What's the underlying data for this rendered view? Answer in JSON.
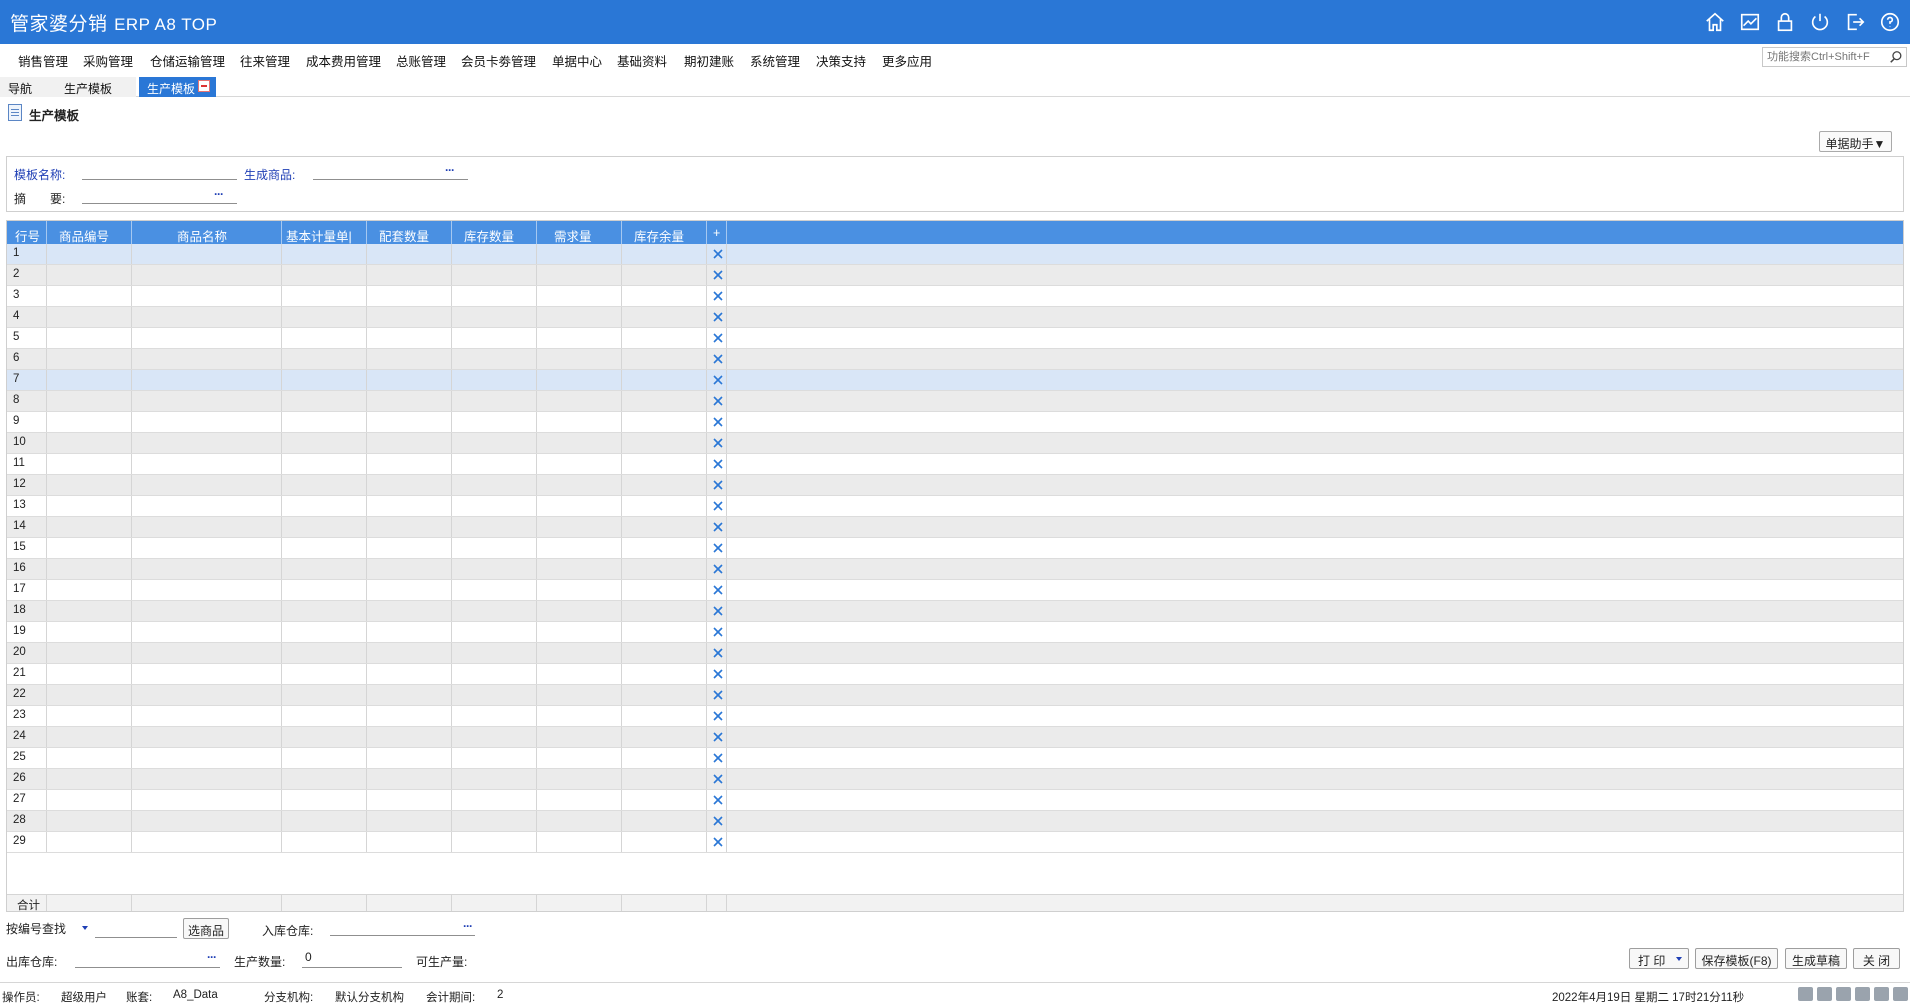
{
  "app": {
    "title_main": "管家婆分销",
    "title_sub": "ERP A8 TOP"
  },
  "title_icons": [
    "home-icon",
    "chart-icon",
    "lock-icon",
    "power-icon",
    "logout-icon",
    "help-icon"
  ],
  "menu": [
    "销售管理",
    "采购管理",
    "仓储运输管理",
    "往来管理",
    "成本费用管理",
    "总账管理",
    "会员卡劵管理",
    "单据中心",
    "基础资料",
    "期初建账",
    "系统管理",
    "决策支持",
    "更多应用"
  ],
  "search": {
    "placeholder": "功能搜索Ctrl+Shift+F"
  },
  "tabs": [
    "导航",
    "生产模板",
    "生产模板"
  ],
  "page": {
    "title": "生产模板",
    "helper_button": "单据助手▼"
  },
  "form": {
    "template_name_label": "模板名称:",
    "template_name_value": "",
    "product_label": "生成商品:",
    "product_value": "",
    "summary_label": "摘　　要:",
    "summary_value": "",
    "dots": "···"
  },
  "grid": {
    "columns": [
      "行号",
      "商品编号",
      "商品名称",
      "基本计量单|",
      "配套数量",
      "库存数量",
      "需求量",
      "库存余量",
      "+"
    ],
    "row_count": 29,
    "selected_rows": [
      1,
      7
    ],
    "total_label": "合计"
  },
  "bottom": {
    "search_mode": "按编号查找",
    "search_value": "",
    "select_product_button": "选商品",
    "in_warehouse_label": "入库仓库:",
    "out_warehouse_label": "出库仓库:",
    "production_qty_label": "生产数量:",
    "production_qty_value": "0",
    "producible_label": "可生产量:",
    "producible_value": "",
    "print_button": "打 印",
    "save_template_button": "保存模板(F8)",
    "generate_draft_button": "生成草稿",
    "close_button": "关 闭"
  },
  "status": {
    "operator_label": "操作员:",
    "operator_value": "超级用户",
    "account_label": "账套:",
    "account_value": "A8_Data",
    "branch_label": "分支机构:",
    "branch_value": "默认分支机构",
    "period_label": "会计期间:",
    "period_value": "2",
    "datetime": "2022年4月19日  星期二  17时21分11秒"
  }
}
